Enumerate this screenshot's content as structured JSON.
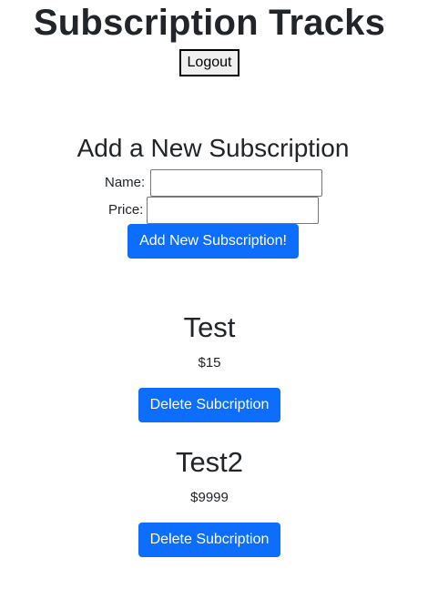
{
  "header": {
    "title": "Subscription Tracks",
    "logout_label": "Logout"
  },
  "form": {
    "title": "Add a New Subscription",
    "name_label": "Name:",
    "name_value": "",
    "price_label": "Price:",
    "price_value": "",
    "submit_label": "Add New Subscription!"
  },
  "subscriptions": [
    {
      "name": "Test",
      "price": "$15",
      "delete_label": "Delete Subcription"
    },
    {
      "name": "Test2",
      "price": "$9999",
      "delete_label": "Delete Subcription"
    }
  ],
  "colors": {
    "primary": "#0d6efd",
    "text": "#212529"
  }
}
